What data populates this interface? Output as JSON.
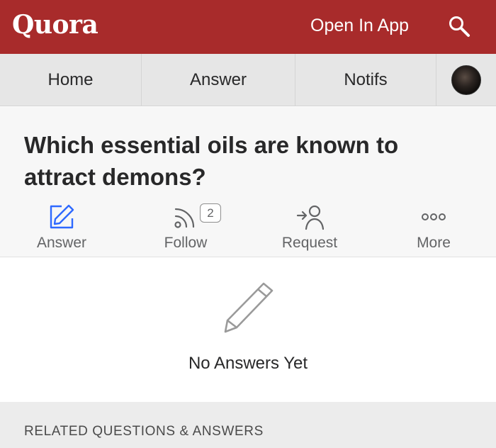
{
  "header": {
    "logo": "Quora",
    "open_in_app": "Open In App",
    "search_icon": "search-icon",
    "background_color": "#a82b2b"
  },
  "nav": {
    "items": [
      {
        "label": "Home"
      },
      {
        "label": "Answer"
      },
      {
        "label": "Notifs"
      }
    ],
    "avatar": "avatar"
  },
  "question": {
    "title": "Which essential oils are known to attract demons?",
    "actions": {
      "answer": {
        "label": "Answer",
        "icon": "edit-icon"
      },
      "follow": {
        "label": "Follow",
        "icon": "rss-icon",
        "count": "2"
      },
      "request": {
        "label": "Request",
        "icon": "request-user-icon"
      },
      "more": {
        "label": "More",
        "icon": "more-dots-icon"
      }
    }
  },
  "empty_state": {
    "icon": "pencil-icon",
    "text": "No Answers Yet"
  },
  "related": {
    "title": "RELATED QUESTIONS & ANSWERS"
  },
  "colors": {
    "accent_blue": "#2e69ff",
    "brand_red": "#a82b2b"
  }
}
